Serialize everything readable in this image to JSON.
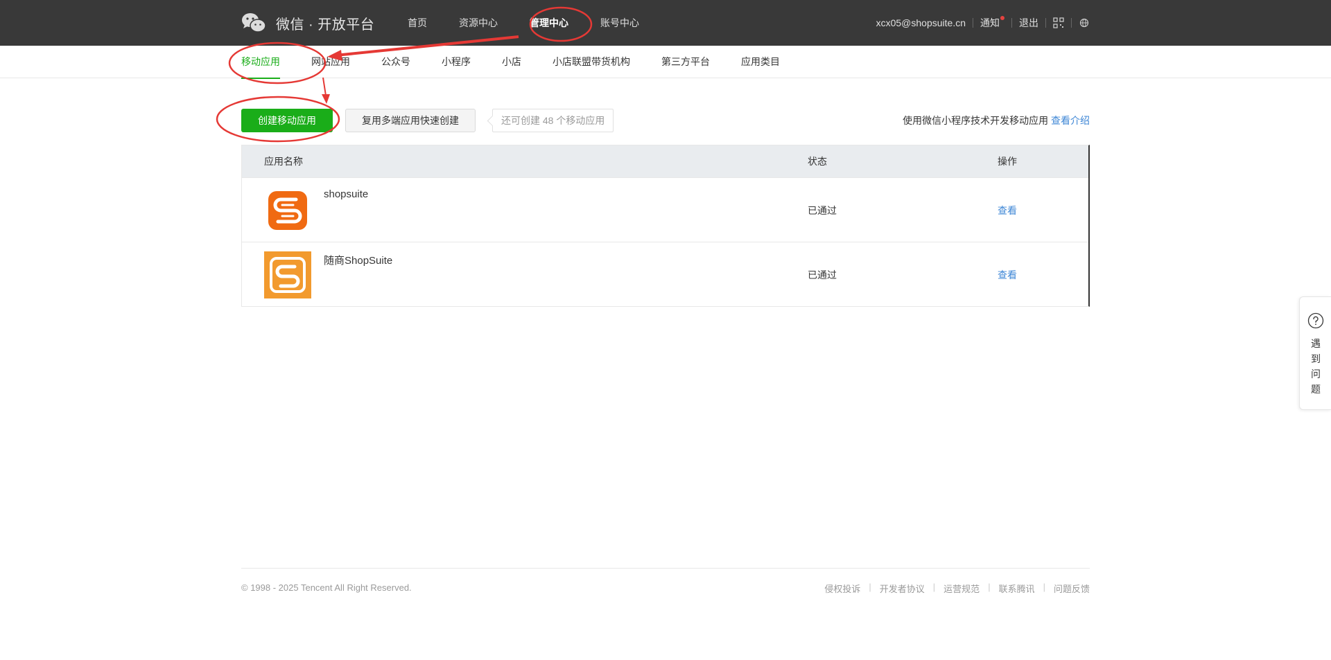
{
  "header": {
    "logo_text": "微信 · 开放平台",
    "nav": [
      "首页",
      "资源中心",
      "管理中心",
      "账号中心"
    ],
    "active_nav": "管理中心",
    "user_email": "xcx05@shopsuite.cn",
    "notify_label": "通知",
    "logout_label": "退出",
    "icons": [
      "qrcode-icon",
      "globe-icon"
    ]
  },
  "subnav": {
    "items": [
      "移动应用",
      "网站应用",
      "公众号",
      "小程序",
      "小店",
      "小店联盟带货机构",
      "第三方平台",
      "应用类目"
    ],
    "active": "移动应用"
  },
  "actions": {
    "create_label": "创建移动应用",
    "reuse_label": "复用多端应用快速创建",
    "quota_text": "还可创建 48 个移动应用",
    "info_text": "使用微信小程序技术开发移动应用",
    "info_link": "查看介绍"
  },
  "table": {
    "headers": {
      "name": "应用名称",
      "status": "状态",
      "op": "操作"
    },
    "rows": [
      {
        "name": "shopsuite",
        "status": "已通过",
        "op": "查看",
        "logo_color": "#f06a12"
      },
      {
        "name": "随商ShopSuite",
        "status": "已通过",
        "op": "查看",
        "logo_color": "#f29a2e"
      }
    ]
  },
  "footer": {
    "copyright": "© 1998 - 2025 Tencent All Right Reserved.",
    "links": [
      "侵权投诉",
      "开发者协议",
      "运营规范",
      "联系腾讯",
      "问题反馈"
    ]
  },
  "help": {
    "label": "遇到问题"
  },
  "colors": {
    "accent": "#1aad19",
    "link": "#3f87d6",
    "topbar": "#393939",
    "annotation": "#e53935"
  }
}
